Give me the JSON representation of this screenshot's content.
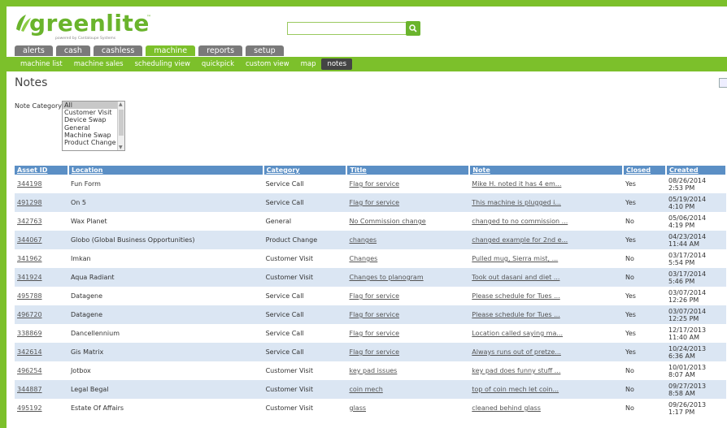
{
  "logo": {
    "text": "greenlite",
    "tm": "™",
    "sub": "powered by Cantaloupe Systems"
  },
  "search": {
    "placeholder": ""
  },
  "tabs": [
    "alerts",
    "cash",
    "cashless",
    "machine",
    "reports",
    "setup"
  ],
  "active_tab": "machine",
  "subnav": [
    "machine list",
    "machine sales",
    "scheduling view",
    "quickpick",
    "custom view",
    "map",
    "notes"
  ],
  "active_subnav": "notes",
  "page_title": "Notes",
  "note_category": {
    "label": "Note Category",
    "options": [
      "All",
      "Customer Visit",
      "Device Swap",
      "General",
      "Machine Swap",
      "Product Change"
    ],
    "selected": "All"
  },
  "table": {
    "headers": [
      "Asset ID",
      "Location",
      "Category",
      "Title",
      "Note",
      "Closed",
      "Created"
    ],
    "rows": [
      {
        "asset": "344198",
        "location": "Fun Form",
        "category": "Service Call",
        "title": "Flag for service",
        "note": "Mike H. noted it has 4 em...",
        "closed": "Yes",
        "date": "08/26/2014",
        "time": "2:53 PM"
      },
      {
        "asset": "491298",
        "location": "On 5",
        "category": "Service Call",
        "title": "Flag for service",
        "note": "This machine is plugged i...",
        "closed": "Yes",
        "date": "05/19/2014",
        "time": "4:10 PM"
      },
      {
        "asset": "342763",
        "location": "Wax Planet",
        "category": "General",
        "title": "No Commission change",
        "note": "changed to no commission ...",
        "closed": "No",
        "date": "05/06/2014",
        "time": "4:19 PM"
      },
      {
        "asset": "344067",
        "location": "Globo (Global Business Opportunities)",
        "category": "Product Change",
        "title": "changes",
        "note": "changed example for 2nd e...",
        "closed": "Yes",
        "date": "04/23/2014",
        "time": "11:44 AM"
      },
      {
        "asset": "341962",
        "location": "Imkan",
        "category": "Customer Visit",
        "title": "Changes",
        "note": "Pulled mug, Sierra mist, ...",
        "closed": "No",
        "date": "03/17/2014",
        "time": "5:54 PM"
      },
      {
        "asset": "341924",
        "location": "Aqua Radiant",
        "category": "Customer Visit",
        "title": "Changes to planogram",
        "note": "Took out dasani and diet ...",
        "closed": "No",
        "date": "03/17/2014",
        "time": "5:46 PM"
      },
      {
        "asset": "495788",
        "location": "Datagene",
        "category": "Service Call",
        "title": "Flag for service",
        "note": "Please schedule for Tues ...",
        "closed": "Yes",
        "date": "03/07/2014",
        "time": "12:26 PM"
      },
      {
        "asset": "496720",
        "location": "Datagene",
        "category": "Service Call",
        "title": "Flag for service",
        "note": "Please schedule for Tues ...",
        "closed": "Yes",
        "date": "03/07/2014",
        "time": "12:25 PM"
      },
      {
        "asset": "338869",
        "location": "Dancellennium",
        "category": "Service Call",
        "title": "Flag for service",
        "note": "Location called saying ma...",
        "closed": "Yes",
        "date": "12/17/2013",
        "time": "11:40 AM"
      },
      {
        "asset": "342614",
        "location": "Gis Matrix",
        "category": "Service Call",
        "title": "Flag for service",
        "note": "Always runs out of pretze...",
        "closed": "Yes",
        "date": "10/24/2013",
        "time": "6:36 AM"
      },
      {
        "asset": "496254",
        "location": "Jotbox",
        "category": "Customer Visit",
        "title": "key pad issues",
        "note": "key pad does funny stuff ...",
        "closed": "No",
        "date": "10/01/2013",
        "time": "8:07 AM"
      },
      {
        "asset": "344887",
        "location": "Legal Begal",
        "category": "Customer Visit",
        "title": "coin mech",
        "note": "top of coin mech let coin...",
        "closed": "No",
        "date": "09/27/2013",
        "time": "8:58 AM"
      },
      {
        "asset": "495192",
        "location": "Estate Of Affairs",
        "category": "Customer Visit",
        "title": "glass",
        "note": "cleaned behind glass",
        "closed": "No",
        "date": "09/26/2013",
        "time": "1:17 PM"
      }
    ]
  },
  "colors": {
    "brand_green": "#7cc02b",
    "header_blue": "#5b8fc5",
    "row_alt": "#dbe6f3"
  },
  "icons": {
    "search": "search-icon",
    "export": "excel-export-icon"
  }
}
